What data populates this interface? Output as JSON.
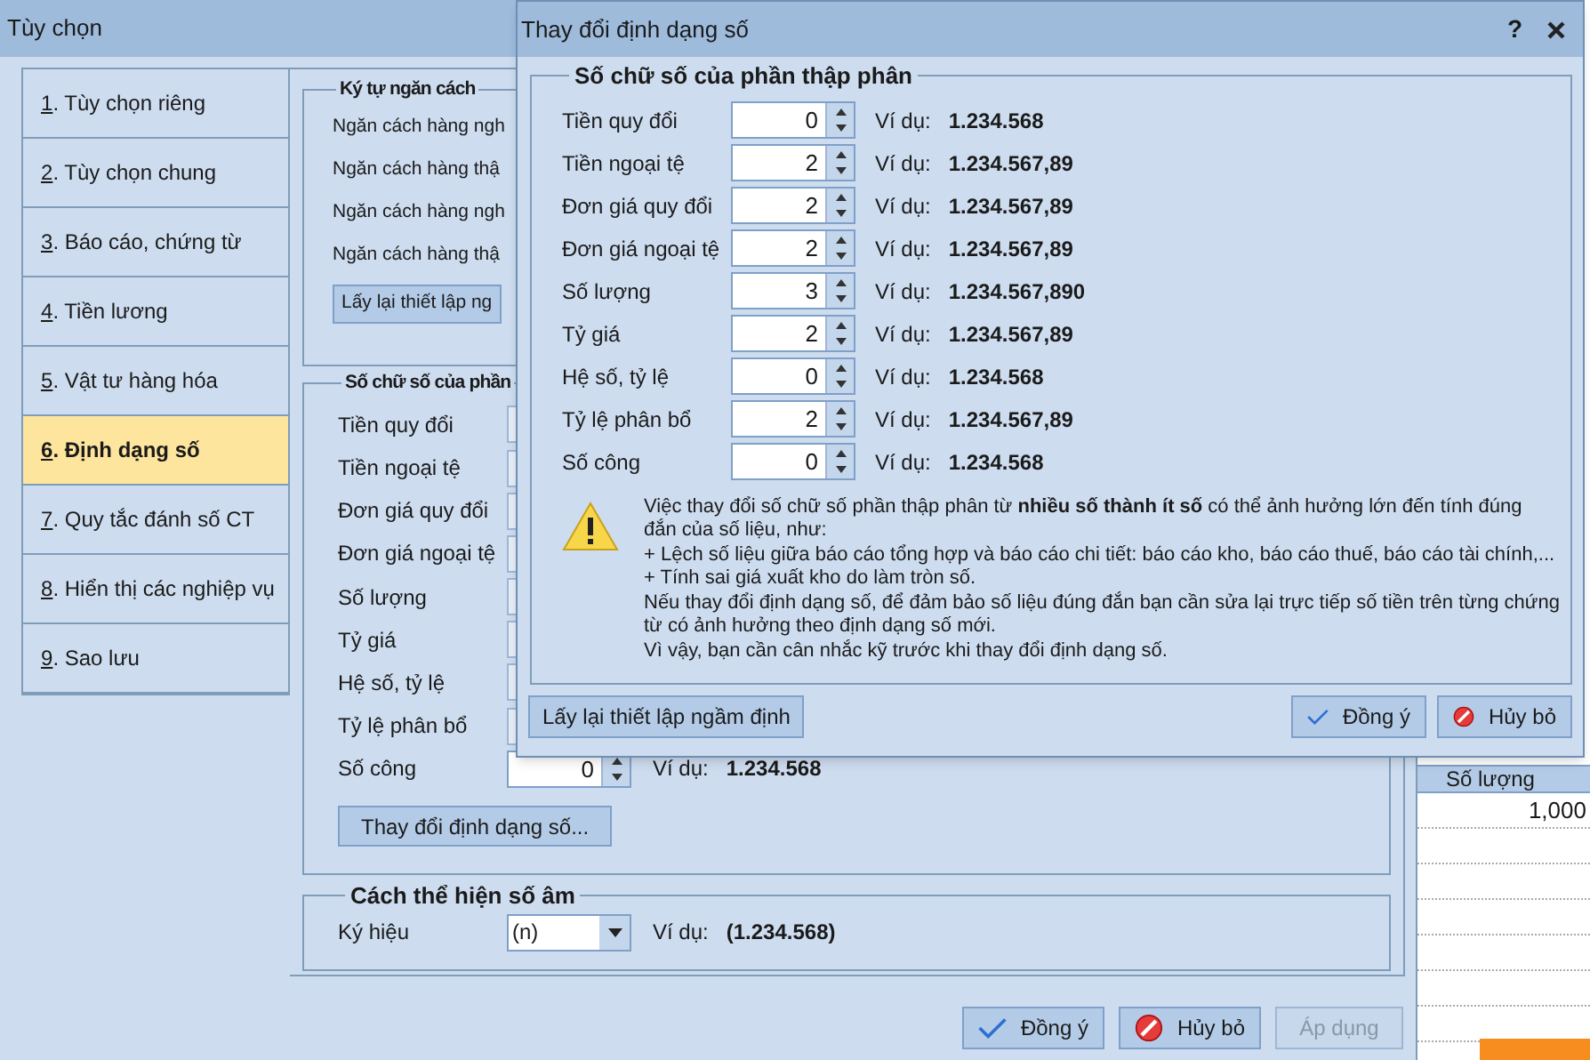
{
  "options_window": {
    "title": "Tùy chọn",
    "sidebar": [
      {
        "key": "1",
        "label": ". Tùy chọn riêng",
        "selected": false
      },
      {
        "key": "2",
        "label": ". Tùy chọn chung",
        "selected": false
      },
      {
        "key": "3",
        "label": ". Báo cáo, chứng từ",
        "selected": false
      },
      {
        "key": "4",
        "label": ". Tiền lương",
        "selected": false
      },
      {
        "key": "5",
        "label": ". Vật tư hàng hóa",
        "selected": false
      },
      {
        "key": "6",
        "label": ". Định dạng số",
        "selected": true
      },
      {
        "key": "7",
        "label": ". Quy tắc đánh số CT",
        "selected": false
      },
      {
        "key": "8",
        "label": ". Hiển thị các nghiệp vụ",
        "selected": false
      },
      {
        "key": "9",
        "label": ". Sao lưu",
        "selected": false
      }
    ],
    "separator_group": {
      "title": "Ký tự ngăn cách",
      "labels": [
        "Ngăn cách hàng ngh",
        "Ngăn cách hàng thậ",
        "Ngăn cách hàng ngh",
        "Ngăn cách hàng thậ"
      ],
      "reset_button": "Lấy lại thiết lập ng"
    },
    "decimal_group": {
      "title": "Số chữ số của phần",
      "rows": [
        {
          "label": "Tiền quy đổi"
        },
        {
          "label": "Tiền ngoại tệ"
        },
        {
          "label": "Đơn giá quy đổi"
        },
        {
          "label": "Đơn giá ngoại tệ"
        },
        {
          "label": "Số lượng"
        },
        {
          "label": "Tỷ giá"
        },
        {
          "label": "Hệ số, tỷ lệ"
        },
        {
          "label": "Tỷ lệ phân bổ"
        },
        {
          "label": "Số công",
          "value": "0",
          "example_label": "Ví dụ:",
          "example": "1.234.568"
        }
      ],
      "change_button": "Thay đổi định dạng số..."
    },
    "negative_group": {
      "title": "Cách thể hiện số âm",
      "label": "Ký hiệu",
      "value": "(n)",
      "example_label": "Ví dụ:",
      "example": "(1.234.568)"
    },
    "buttons": [
      {
        "label": "Đồng ý",
        "kind": "ok",
        "disabled": false
      },
      {
        "label": "Hủy bỏ",
        "kind": "cancel",
        "disabled": false
      },
      {
        "label": "Áp dụng",
        "kind": "plain",
        "disabled": true
      }
    ]
  },
  "background_grid": {
    "column_header": "Số lượng",
    "cells": [
      "1,000"
    ]
  },
  "dialog": {
    "title": "Thay đổi định dạng số",
    "help_button": "?",
    "group_title": "Số chữ số của phần thập phân",
    "rows": [
      {
        "label": "Tiền quy đổi",
        "value": "0",
        "example_label": "Ví dụ:",
        "example": "1.234.568"
      },
      {
        "label": "Tiền ngoại tệ",
        "value": "2",
        "example_label": "Ví dụ:",
        "example": "1.234.567,89"
      },
      {
        "label": "Đơn giá quy đổi",
        "value": "2",
        "example_label": "Ví dụ:",
        "example": "1.234.567,89"
      },
      {
        "label": "Đơn giá ngoại tệ",
        "value": "2",
        "example_label": "Ví dụ:",
        "example": "1.234.567,89"
      },
      {
        "label": "Số lượng",
        "value": "3",
        "example_label": "Ví dụ:",
        "example": "1.234.567,890"
      },
      {
        "label": "Tỷ giá",
        "value": "2",
        "example_label": "Ví dụ:",
        "example": "1.234.567,89"
      },
      {
        "label": "Hệ số, tỷ lệ",
        "value": "0",
        "example_label": "Ví dụ:",
        "example": "1.234.568"
      },
      {
        "label": "Tỷ lệ phân bổ",
        "value": "2",
        "example_label": "Ví dụ:",
        "example": "1.234.567,89"
      },
      {
        "label": "Số công",
        "value": "0",
        "example_label": "Ví dụ:",
        "example": "1.234.568"
      }
    ],
    "warning": "Việc thay đổi số chữ số phần thập phân từ **nhiều số thành ít số** có thể ảnh hưởng lớn đến tính đúng đắn của số liệu, như:\n+ Lệch số liệu giữa báo cáo tổng hợp và báo cáo chi tiết: báo cáo kho, báo cáo thuế, báo cáo tài chính,...\n+ Tính sai giá xuất kho do làm tròn số.\nNếu thay đổi định dạng số, để đảm bảo số liệu đúng đắn bạn cần sửa lại trực tiếp số tiền trên từng chứng từ có ảnh hưởng theo định dạng số mới.\nVì vậy, bạn cần cân nhắc kỹ trước khi thay đổi định dạng số.",
    "reset_button": "Lấy lại thiết lập ngầm định",
    "buttons": [
      {
        "label": "Đồng ý",
        "kind": "ok",
        "disabled": false
      },
      {
        "label": "Hủy bỏ",
        "kind": "cancel",
        "disabled": false
      }
    ]
  }
}
